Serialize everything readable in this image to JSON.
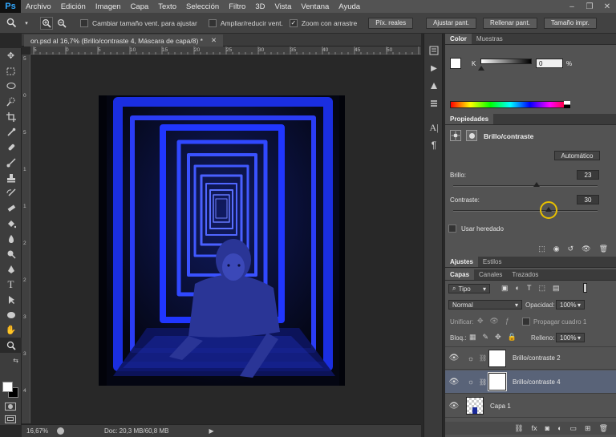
{
  "app": {
    "logo": "Ps"
  },
  "menu": [
    "Archivo",
    "Edición",
    "Imagen",
    "Capa",
    "Texto",
    "Selección",
    "Filtro",
    "3D",
    "Vista",
    "Ventana",
    "Ayuda"
  ],
  "window_controls": {
    "minimize": "–",
    "restore": "❐",
    "close": "✕"
  },
  "options": {
    "fit_window": "Cambiar tamaño vent. para ajustar",
    "resize_window": "Ampliar/reducir vent.",
    "scrubby_zoom": "Zoom con arrastre",
    "actual_pixels": "Píx. reales",
    "fit_screen": "Ajustar pant.",
    "fill_screen": "Rellenar pant.",
    "print_size": "Tamaño impr."
  },
  "document": {
    "tab_title": "on.psd al 16,7% (Brillo/contraste 4, Máscara de capa/8) *",
    "ruler_top": [
      "5",
      "0",
      "5",
      "10",
      "15",
      "20",
      "25",
      "30",
      "35",
      "40",
      "45",
      "50"
    ],
    "ruler_left": [
      "5",
      "0",
      "5",
      "1",
      "1",
      "2",
      "2",
      "3",
      "3",
      "4"
    ]
  },
  "status": {
    "zoom": "16,67%",
    "doc": "Doc: 20,3 MB/60,8 MB"
  },
  "color_panel": {
    "tabs": [
      "Color",
      "Muestras"
    ],
    "channel": "K",
    "value": "0",
    "unit": "%"
  },
  "properties": {
    "tab": "Propiedades",
    "title": "Brillo/contraste",
    "auto_button": "Automático",
    "brightness_label": "Brillo:",
    "brightness": "23",
    "brightness_level": 0.58,
    "contrast_label": "Contraste:",
    "contrast": "30",
    "contrast_level": 0.6,
    "legacy_label": "Usar heredado"
  },
  "adjust_tabs": [
    "Ajustes",
    "Estilos"
  ],
  "layers": {
    "tabs": [
      "Capas",
      "Canales",
      "Trazados"
    ],
    "filter": "Tipo",
    "blend_mode": "Normal",
    "opacity_label": "Opacidad:",
    "opacity": "100%",
    "unify_label": "Unificar:",
    "propagate_label": "Propagar cuadro 1",
    "lock_label": "Bloq.:",
    "fill_label": "Relleno:",
    "fill": "100%",
    "items": [
      {
        "name": "Brillo/contraste 2",
        "selected": false
      },
      {
        "name": "Brillo/contraste 4",
        "selected": true
      },
      {
        "name": "Capa 1",
        "selected": false
      }
    ]
  }
}
